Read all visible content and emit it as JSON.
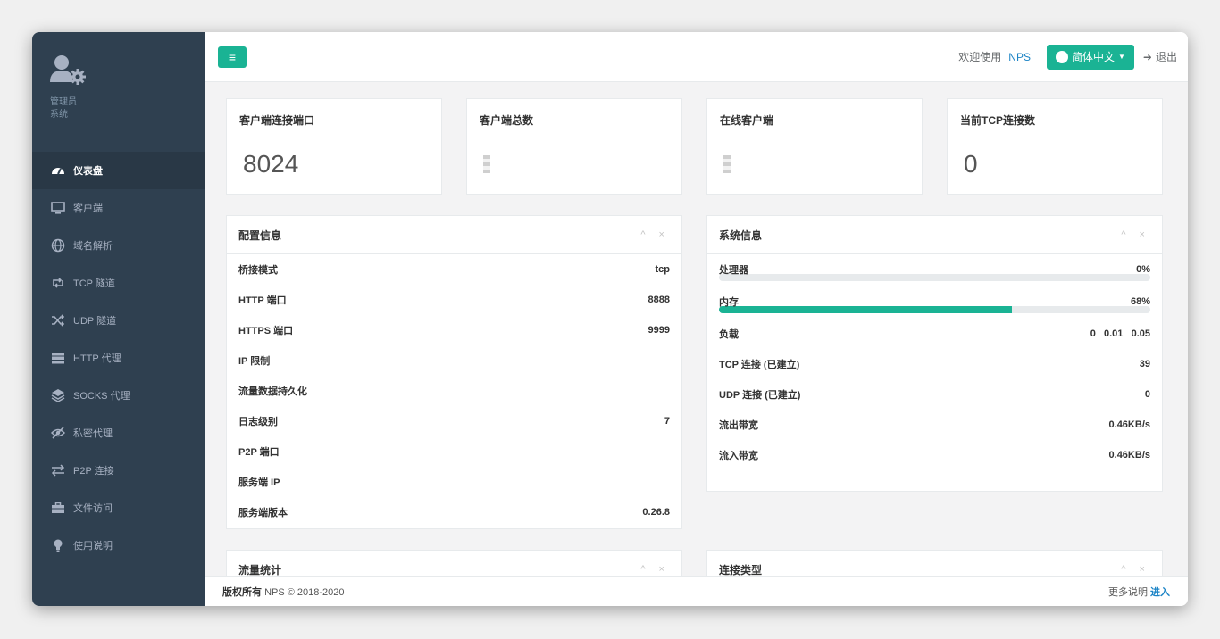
{
  "sidebar": {
    "role_line1": "管理员",
    "role_line2": "系统",
    "items": [
      {
        "label": "仪表盘",
        "icon": "dashboard-icon"
      },
      {
        "label": "客户端",
        "icon": "monitor-icon"
      },
      {
        "label": "域名解析",
        "icon": "globe-icon"
      },
      {
        "label": "TCP 隧道",
        "icon": "retweet-icon"
      },
      {
        "label": "UDP 隧道",
        "icon": "random-icon"
      },
      {
        "label": "HTTP 代理",
        "icon": "server-icon"
      },
      {
        "label": "SOCKS 代理",
        "icon": "layers-icon"
      },
      {
        "label": "私密代理",
        "icon": "eye-slash-icon"
      },
      {
        "label": "P2P 连接",
        "icon": "exchange-icon"
      },
      {
        "label": "文件访问",
        "icon": "briefcase-icon"
      },
      {
        "label": "使用说明",
        "icon": "lightbulb-icon"
      }
    ]
  },
  "header": {
    "menu_icon": "≡",
    "welcome": "欢迎使用",
    "brand": "NPS",
    "language": "简体中文",
    "logout": "退出"
  },
  "stats": [
    {
      "title": "客户端连接端口",
      "value": "8024"
    },
    {
      "title": "客户端总数",
      "value": ""
    },
    {
      "title": "在线客户端",
      "value": ""
    },
    {
      "title": "当前TCP连接数",
      "value": "0"
    }
  ],
  "config": {
    "title": "配置信息",
    "tools": "^ ×",
    "rows": [
      {
        "label": "桥接模式",
        "value": "tcp"
      },
      {
        "label": "HTTP 端口",
        "value": "8888"
      },
      {
        "label": "HTTPS 端口",
        "value": "9999"
      },
      {
        "label": "IP 限制",
        "value": ""
      },
      {
        "label": "流量数据持久化",
        "value": ""
      },
      {
        "label": "日志级别",
        "value": "7"
      },
      {
        "label": "P2P 端口",
        "value": ""
      },
      {
        "label": "服务端 IP",
        "value": ""
      },
      {
        "label": "服务端版本",
        "value": "0.26.8"
      }
    ]
  },
  "system": {
    "title": "系统信息",
    "tools": "^ ×",
    "cpu": {
      "label": "处理器",
      "value": "0%",
      "percent": 0
    },
    "memory": {
      "label": "内存",
      "value": "68%",
      "percent": 68
    },
    "rows": [
      {
        "label": "负载",
        "value": "0   0.01   0.05"
      },
      {
        "label": "TCP 连接 (已建立)",
        "value": "39"
      },
      {
        "label": "UDP 连接 (已建立)",
        "value": "0"
      },
      {
        "label": "流出带宽",
        "value": "0.46KB/s"
      },
      {
        "label": "流入带宽",
        "value": "0.46KB/s"
      }
    ]
  },
  "bottom_boxes": [
    {
      "title": "流量统计",
      "tools": "^ ×"
    },
    {
      "title": "连接类型",
      "tools": "^ ×"
    }
  ],
  "footer": {
    "copyright_bold": "版权所有",
    "copyright_rest": "NPS © 2018-2020",
    "more": "更多说明",
    "enter": "进入"
  },
  "colors": {
    "accent": "#1ab394",
    "sidebar": "#2f4050",
    "link": "#1c84c6"
  }
}
